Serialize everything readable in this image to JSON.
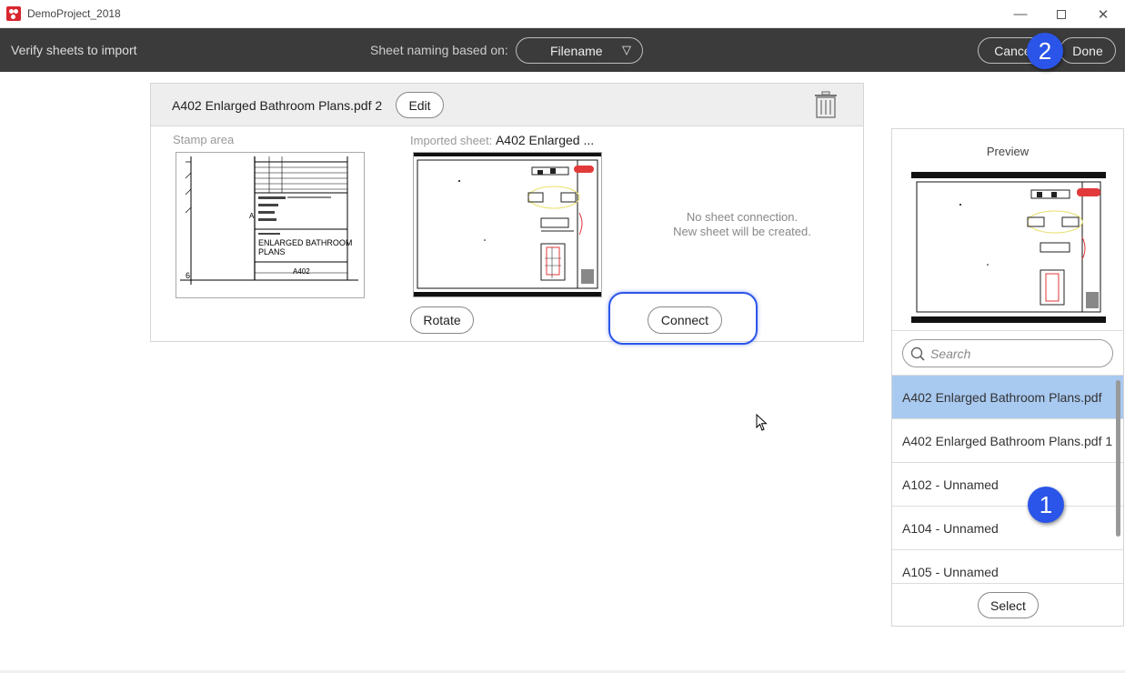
{
  "window": {
    "title": "DemoProject_2018",
    "min_glyph": "—",
    "close_glyph": "✕"
  },
  "toolbar": {
    "title": "Verify sheets to import",
    "naming_label": "Sheet naming based on:",
    "naming_value": "Filename",
    "naming_glyph": "▽",
    "cancel_label": "Cancel",
    "done_label": "Done"
  },
  "badges": {
    "list_badge": "1",
    "done_badge": "2",
    "color": "#2b55e8"
  },
  "sheet_card": {
    "name": "A402 Enlarged Bathroom Plans.pdf 2",
    "edit_label": "Edit",
    "stamp_label": "Stamp area",
    "imported_label": "Imported sheet:",
    "imported_value": "A402 Enlarged ...",
    "no_connection_line1": "No sheet connection.",
    "no_connection_line2": "New sheet will be created.",
    "rotate_label": "Rotate",
    "connect_label": "Connect",
    "stamp": {
      "title_line1": "ENLARGED BATHROOM",
      "title_line2": "PLANS",
      "sheet_number": "A402",
      "left_number": "6",
      "left_letter": "A"
    }
  },
  "preview_panel": {
    "label": "Preview",
    "search_placeholder": "Search",
    "items": [
      {
        "label": "A402 Enlarged Bathroom Plans.pdf",
        "selected": true
      },
      {
        "label": "A402 Enlarged Bathroom Plans.pdf 1",
        "selected": false
      },
      {
        "label": "A102 - Unnamed",
        "selected": false
      },
      {
        "label": "A104 - Unnamed",
        "selected": false
      },
      {
        "label": "A105 - Unnamed",
        "selected": false
      }
    ],
    "select_label": "Select",
    "selected_color": "#a8c9f0"
  }
}
